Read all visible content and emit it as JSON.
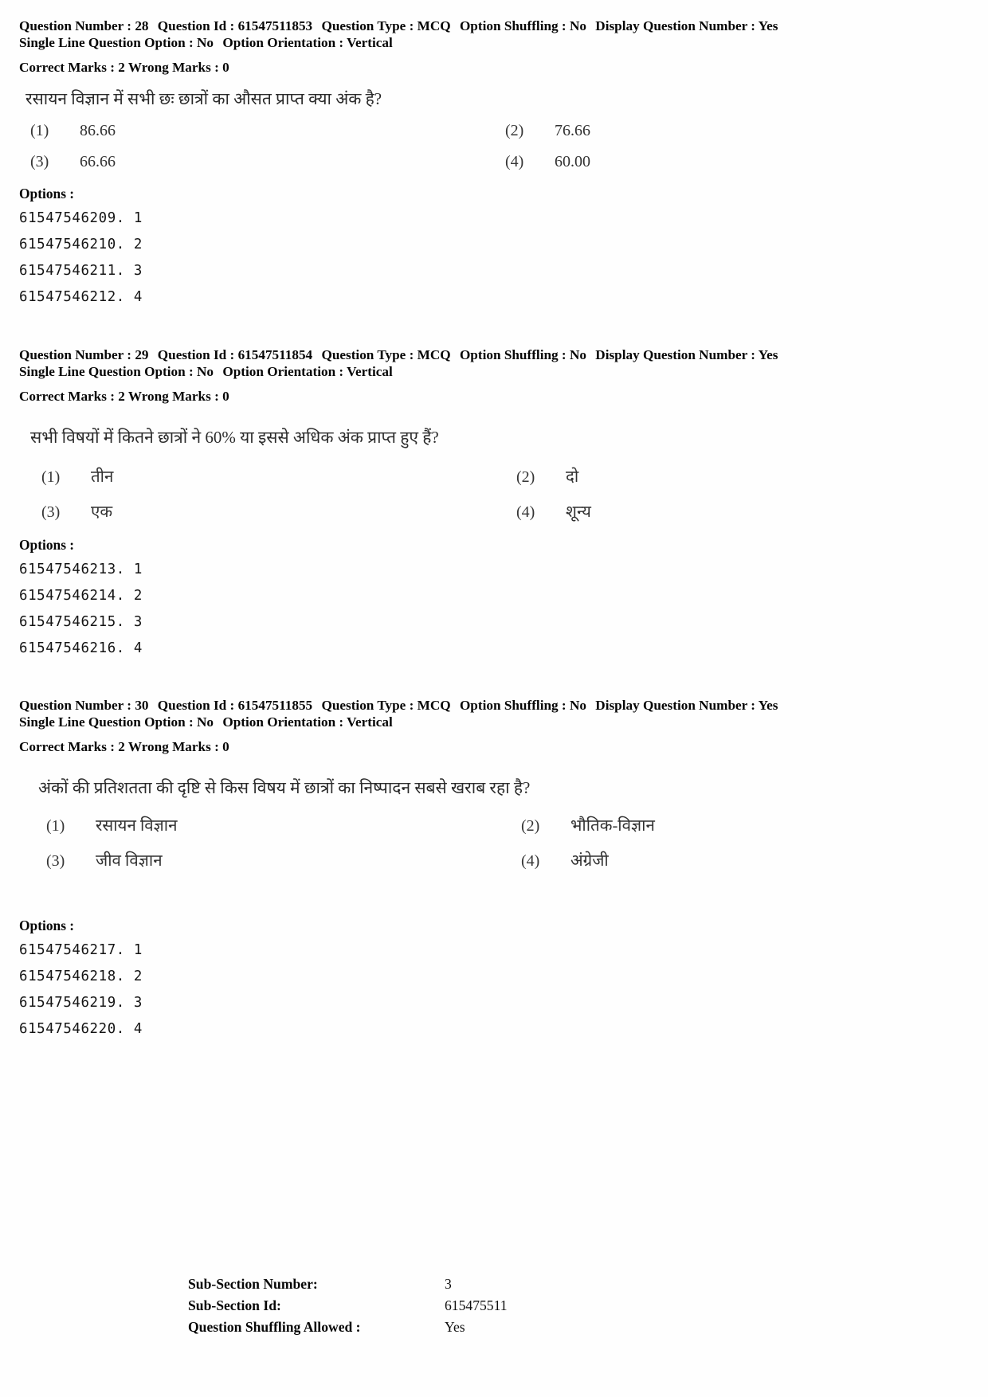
{
  "document": {
    "type": "exam-question-paper",
    "language": "Hindi"
  },
  "questions": [
    {
      "meta": {
        "question_number_label": "Question Number :",
        "question_number": "28",
        "question_id_label": "Question Id :",
        "question_id": "61547511853",
        "question_type_label": "Question Type :",
        "question_type": "MCQ",
        "option_shuffling_label": "Option Shuffling :",
        "option_shuffling": "No",
        "display_question_number_label": "Display Question Number :",
        "display_question_number": "Yes",
        "single_line_question_option_label": "Single Line Question Option :",
        "single_line_question_option": "No",
        "option_orientation_label": "Option Orientation :",
        "option_orientation": "Vertical",
        "correct_marks_label": "Correct Marks :",
        "correct_marks": "2",
        "wrong_marks_label": "Wrong Marks :",
        "wrong_marks": "0"
      },
      "stem": "रसायन विज्ञान में सभी छः छात्रों का औसत प्राप्त क्या अंक है?",
      "options": [
        {
          "num": "(1)",
          "text": "86.66"
        },
        {
          "num": "(2)",
          "text": "76.66"
        },
        {
          "num": "(3)",
          "text": "66.66"
        },
        {
          "num": "(4)",
          "text": "60.00"
        }
      ],
      "options_label": "Options :",
      "option_ids": [
        "61547546209. 1",
        "61547546210. 2",
        "61547546211. 3",
        "61547546212. 4"
      ]
    },
    {
      "meta": {
        "question_number_label": "Question Number :",
        "question_number": "29",
        "question_id_label": "Question Id :",
        "question_id": "61547511854",
        "question_type_label": "Question Type :",
        "question_type": "MCQ",
        "option_shuffling_label": "Option Shuffling :",
        "option_shuffling": "No",
        "display_question_number_label": "Display Question Number :",
        "display_question_number": "Yes",
        "single_line_question_option_label": "Single Line Question Option :",
        "single_line_question_option": "No",
        "option_orientation_label": "Option Orientation :",
        "option_orientation": "Vertical",
        "correct_marks_label": "Correct Marks :",
        "correct_marks": "2",
        "wrong_marks_label": "Wrong Marks :",
        "wrong_marks": "0"
      },
      "stem": "सभी विषयों में कितने छात्रों ने 60% या इससे अधिक अंक प्राप्त हुए हैं?",
      "options": [
        {
          "num": "(1)",
          "text": "तीन"
        },
        {
          "num": "(2)",
          "text": "दो"
        },
        {
          "num": "(3)",
          "text": "एक"
        },
        {
          "num": "(4)",
          "text": "शून्य"
        }
      ],
      "options_label": "Options :",
      "option_ids": [
        "61547546213. 1",
        "61547546214. 2",
        "61547546215. 3",
        "61547546216. 4"
      ]
    },
    {
      "meta": {
        "question_number_label": "Question Number :",
        "question_number": "30",
        "question_id_label": "Question Id :",
        "question_id": "61547511855",
        "question_type_label": "Question Type :",
        "question_type": "MCQ",
        "option_shuffling_label": "Option Shuffling :",
        "option_shuffling": "No",
        "display_question_number_label": "Display Question Number :",
        "display_question_number": "Yes",
        "single_line_question_option_label": "Single Line Question Option :",
        "single_line_question_option": "No",
        "option_orientation_label": "Option Orientation :",
        "option_orientation": "Vertical",
        "correct_marks_label": "Correct Marks :",
        "correct_marks": "2",
        "wrong_marks_label": "Wrong Marks :",
        "wrong_marks": "0"
      },
      "stem": "अंकों की प्रतिशतता की दृष्टि से किस विषय में छात्रों का निष्पादन सबसे खराब रहा है?",
      "options": [
        {
          "num": "(1)",
          "text": "रसायन विज्ञान"
        },
        {
          "num": "(2)",
          "text": "भौतिक-विज्ञान"
        },
        {
          "num": "(3)",
          "text": "जीव विज्ञान"
        },
        {
          "num": "(4)",
          "text": "अंग्रेजी"
        }
      ],
      "options_label": "Options :",
      "option_ids": [
        "61547546217. 1",
        "61547546218. 2",
        "61547546219. 3",
        "61547546220. 4"
      ]
    }
  ],
  "sub_section": {
    "rows": [
      {
        "label": "Sub-Section Number:",
        "value": "3"
      },
      {
        "label": "Sub-Section Id:",
        "value": "615475511"
      },
      {
        "label": "Question Shuffling Allowed :",
        "value": "Yes"
      }
    ]
  }
}
